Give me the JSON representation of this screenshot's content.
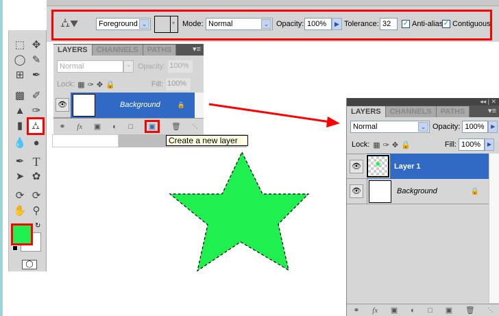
{
  "options_bar": {
    "tool_icon": "paint-bucket-icon",
    "fill_source": "Foreground",
    "mode_label": "Mode:",
    "mode_value": "Normal",
    "opacity_label": "Opacity:",
    "opacity_value": "100%",
    "tolerance_label": "Tolerance:",
    "tolerance_value": "32",
    "anti_alias_label": "Anti-alias",
    "anti_alias_checked": true,
    "contiguous_label": "Contiguous",
    "contiguous_checked": true
  },
  "colors": {
    "foreground": "#1ff050",
    "background": "#ffffff",
    "selection": "#316ac5",
    "highlight": "#ff0000"
  },
  "small_panel": {
    "tabs": [
      "LAYERS",
      "CHANNELS",
      "PATHS"
    ],
    "blend_mode": "Normal",
    "opacity_label": "Opacity:",
    "opacity_value": "100%",
    "lock_label": "Lock:",
    "fill_label": "Fill:",
    "fill_value": "100%",
    "layers": [
      {
        "name": "Background",
        "locked": true,
        "selected": true
      }
    ],
    "tooltip": "Create a new layer"
  },
  "large_panel": {
    "tabs": [
      "LAYERS",
      "CHANNELS",
      "PATHS"
    ],
    "blend_mode": "Normal",
    "opacity_label": "Opacity:",
    "opacity_value": "100%",
    "lock_label": "Lock:",
    "fill_label": "Fill:",
    "fill_value": "100%",
    "layers": [
      {
        "name": "Layer 1",
        "locked": false,
        "selected": true
      },
      {
        "name": "Background",
        "locked": true,
        "selected": false
      }
    ]
  }
}
